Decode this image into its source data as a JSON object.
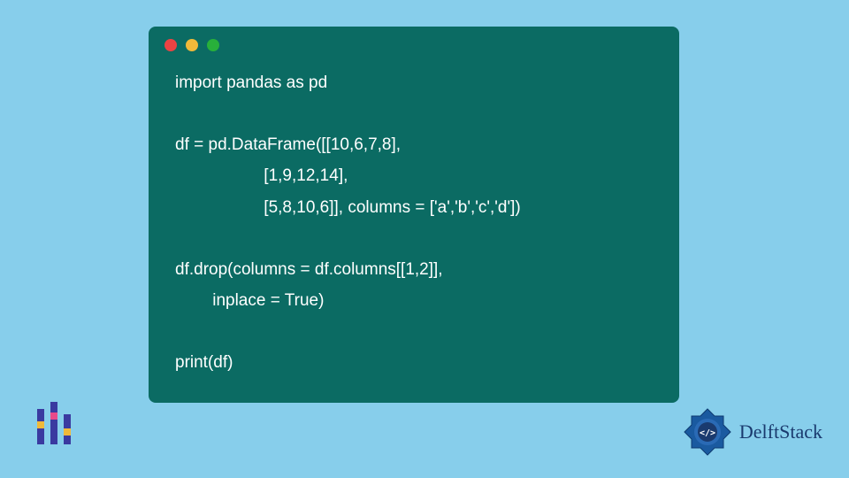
{
  "code": {
    "line1": "import pandas as pd",
    "line2": "",
    "line3": "df = pd.DataFrame([[10,6,7,8],",
    "line4": "                   [1,9,12,14],",
    "line5": "                   [5,8,10,6]], columns = ['a','b','c','d'])",
    "line6": "",
    "line7": "df.drop(columns = df.columns[[1,2]],",
    "line8": "        inplace = True)",
    "line9": "",
    "line10": "print(df)"
  },
  "branding": {
    "right_text": "DelftStack"
  },
  "colors": {
    "background": "#87ceeb",
    "code_bg": "#0b6b63",
    "code_text": "#ffffff",
    "brand_blue": "#1a3a6e"
  }
}
